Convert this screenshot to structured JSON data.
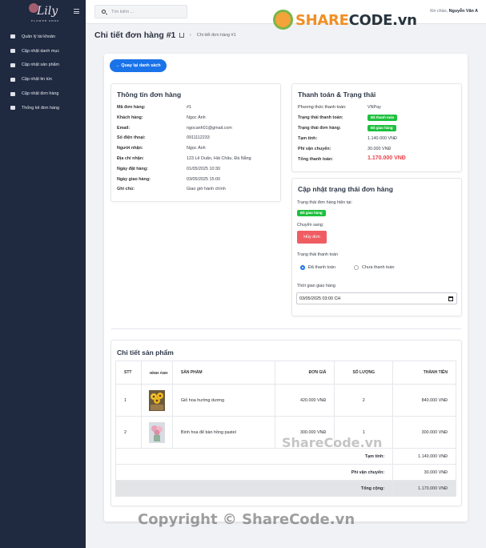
{
  "sidebar": {
    "logo": "Lily",
    "logo_sub": "FLOWER SHOP",
    "items": [
      {
        "label": "Quản lý tài khoản",
        "icon": "user-icon"
      },
      {
        "label": "Cập nhật danh mục",
        "icon": "folder-icon"
      },
      {
        "label": "Cập nhật sản phẩm",
        "icon": "box-icon"
      },
      {
        "label": "Cập nhật tin tức",
        "icon": "newspaper-icon"
      },
      {
        "label": "Cập nhật đơn hàng",
        "icon": "cart-icon"
      },
      {
        "label": "Thống kê đơn hàng",
        "icon": "chart-icon"
      }
    ]
  },
  "topbar": {
    "search_placeholder": "Tìm kiếm ...",
    "greeting": "Xin chào,",
    "user": "Nguyễn Văn A"
  },
  "brand": {
    "name_a": "SHARE",
    "name_b": "CODE.vn"
  },
  "page": {
    "title": "Chi tiết đơn hàng #1",
    "breadcrumb": "Chi tiết đơn hàng #1",
    "back_label": "← Quay lại danh sách"
  },
  "order_info": {
    "heading": "Thông tin đơn hàng",
    "rows": [
      {
        "label": "Mã đơn hàng:",
        "value": "#1"
      },
      {
        "label": "Khách hàng:",
        "value": "Ngọc Ánh"
      },
      {
        "label": "Email:",
        "value": "ngocanh01@gmail.com"
      },
      {
        "label": "Số điện thoại:",
        "value": "0911112233"
      },
      {
        "label": "Người nhận:",
        "value": "Ngọc Ánh"
      },
      {
        "label": "Địa chỉ nhận:",
        "value": "123 Lê Duẩn, Hải Châu, Đà Nẵng"
      },
      {
        "label": "Ngày đặt hàng:",
        "value": "01/05/2025 10:30"
      },
      {
        "label": "Ngày giao hàng:",
        "value": "03/05/2025 15:00"
      },
      {
        "label": "Ghi chú:",
        "value": "Giao giờ hành chính"
      }
    ]
  },
  "payment": {
    "heading": "Thanh toán & Trạng thái",
    "method_label": "Phương thức thanh toán:",
    "method": "VNPay",
    "pay_status_label": "Trạng thái thanh toán:",
    "pay_status": "Đã thanh toán",
    "order_status_label": "Trạng thái đơn hàng:",
    "order_status": "Đã giao hàng",
    "subtotal_label": "Tạm tính:",
    "subtotal": "1.140.000 VNĐ",
    "shipping_label": "Phí vận chuyển:",
    "shipping": "30.000 VNĐ",
    "total_label": "Tổng thanh toán:",
    "total": "1.170.000 VNĐ"
  },
  "update": {
    "heading": "Cập nhật trạng thái đơn hàng",
    "current_label": "Trạng thái đơn hàng hiện tại:",
    "current": "Đã giao hàng",
    "move_label": "Chuyển sang:",
    "cancel": "Hủy đơn",
    "pay_label": "Trạng thái thanh toán",
    "paid": "Đã thanh toán",
    "unpaid": "Chưa thanh toán",
    "time_label": "Thời gian giao hàng",
    "time_value": "03/05/2025 03:00 CH"
  },
  "products": {
    "heading": "Chi tiết sản phẩm",
    "columns": [
      "STT",
      "HÌNH ẢNH",
      "SẢN PHẨM",
      "ĐƠN GIÁ",
      "SỐ LƯỢNG",
      "THÀNH TIỀN"
    ],
    "rows": [
      {
        "stt": "1",
        "name": "Giỏ hoa hướng dương",
        "price": "420.000 VNĐ",
        "qty": "2",
        "total": "840.000 VNĐ"
      },
      {
        "stt": "2",
        "name": "Bình hoa để bàn hồng pastel",
        "price": "300.000 VNĐ",
        "qty": "1",
        "total": "300.000 VNĐ"
      }
    ],
    "sub_label": "Tạm tính:",
    "sub": "1.140.000 VNĐ",
    "ship_label": "Phí vận chuyển:",
    "ship": "30.000 VNĐ",
    "total_label": "Tổng cộng:",
    "total": "1.170.000 VNĐ"
  },
  "watermark": {
    "mid": "ShareCode.vn",
    "bottom": "Copyright © ShareCode.vn"
  }
}
